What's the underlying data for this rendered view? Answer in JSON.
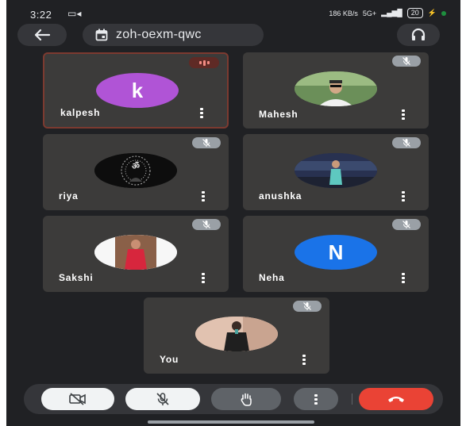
{
  "status_bar": {
    "time": "3:22",
    "net_speed": "186 KB/s",
    "network": "5G+",
    "battery": "20"
  },
  "header": {
    "meeting_code": "zoh-oexm-qwc",
    "icons": [
      "back-arrow-icon",
      "calendar-icon",
      "headphones-icon"
    ]
  },
  "participants": [
    {
      "name": "kalpesh",
      "avatar_type": "initial",
      "initial": "k",
      "avatar_color": "#b054d6",
      "speaking": true
    },
    {
      "name": "Mahesh",
      "avatar_type": "photo",
      "muted": true
    },
    {
      "name": "riya",
      "avatar_type": "photo",
      "muted": true
    },
    {
      "name": "anushka",
      "avatar_type": "photo",
      "muted": true
    },
    {
      "name": "Sakshi",
      "avatar_type": "photo",
      "muted": true
    },
    {
      "name": "Neha",
      "avatar_type": "initial",
      "initial": "N",
      "avatar_color": "#1a73e8",
      "muted": true
    },
    {
      "name": "You",
      "avatar_type": "photo",
      "muted": true
    }
  ],
  "controls": {
    "icons": [
      "camera-off-icon",
      "mic-off-icon",
      "raise-hand-icon",
      "more-options-icon",
      "end-call-icon"
    ],
    "end_call_color": "#ea4335"
  },
  "colors": {
    "background": "#202124",
    "tile": "#3c3b3a",
    "active_border": "#7c3a30"
  }
}
